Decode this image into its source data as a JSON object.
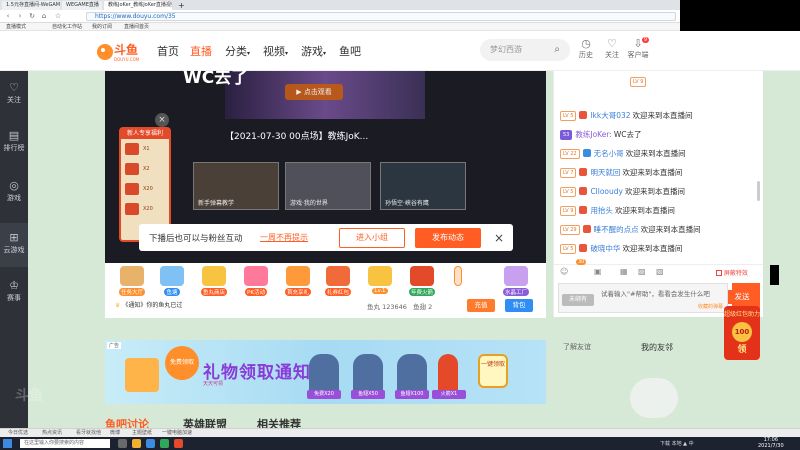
{
  "browser": {
    "tabs": [
      {
        "label": "1.5元存直播间-WeGAME官方"
      },
      {
        "label": "WEGAME直播"
      },
      {
        "label": "教练JoKer_教练JoKer直播视频_斗鱼"
      }
    ],
    "url": "https://www.douyu.com/35",
    "bookmarks": [
      "直播模式",
      "自动化工作站",
      "我的订阅",
      "直播间首页"
    ]
  },
  "header": {
    "logo_text": "斗鱼",
    "logo_sub": "DOUYU.COM",
    "nav": [
      {
        "label": "首页"
      },
      {
        "label": "直播"
      },
      {
        "label": "分类"
      },
      {
        "label": "视频"
      },
      {
        "label": "游戏"
      },
      {
        "label": "鱼吧"
      }
    ],
    "search_placeholder": "梦幻西游",
    "icons": [
      {
        "label": "历史",
        "icon": "clock-icon"
      },
      {
        "label": "关注",
        "icon": "heart-icon"
      },
      {
        "label": "客户端",
        "icon": "download-icon"
      }
    ],
    "client_badge": "9"
  },
  "sidebar": {
    "items": [
      {
        "label": "关注",
        "icon": "heart-icon"
      },
      {
        "label": "排行榜",
        "icon": "rank-icon"
      },
      {
        "label": "游戏",
        "icon": "gamepad-icon"
      },
      {
        "label": "云游戏",
        "icon": "cloud-game-icon"
      },
      {
        "label": "赛事",
        "icon": "trophy-icon"
      }
    ]
  },
  "player": {
    "streamer_tag": "WC去了",
    "play_button": "点击观看",
    "video_title": "【2021-07-30 00点场】教练JoK...",
    "newbie_title": "新人专享福利",
    "newbie_items": [
      "X1",
      "X2",
      "X20",
      "X20"
    ],
    "thumbs": [
      "新手弹幕教学",
      "游戏·我的世界",
      "孙悟空·峡谷有鹰"
    ],
    "fan_bar": {
      "text": "下播后也可以与粉丝互动",
      "link": "一周不再提示",
      "join_button": "进入小组",
      "post_button": "发布动态"
    }
  },
  "giftbar": {
    "gifts": [
      {
        "label": "任务大厅",
        "color": "#ff8f2a"
      },
      {
        "label": "鱼塘",
        "color": "#2f8df3"
      },
      {
        "label": "鱼丸商店",
        "color": "#ff5d23"
      },
      {
        "label": "PK活动",
        "color": "#ff5d23"
      },
      {
        "label": "首充享礼",
        "color": "#ff5d23"
      },
      {
        "label": "礼券红包",
        "color": "#ff5d23"
      },
      {
        "label": "Lv.1",
        "color": "#ff8f2a"
      },
      {
        "label": "年费火箭",
        "color": "#2fa85a"
      },
      {
        "label": "水晶工厂",
        "color": "#8a5cd9"
      }
    ],
    "rank_text": "《通知》你的鱼丸已过",
    "fish_balls": "鱼丸 123646",
    "fish_fins": "鱼翅 2",
    "recharge": "充值",
    "backpack": "背包"
  },
  "chat": {
    "top_label": "LV 9",
    "messages": [
      {
        "level": "LV 5",
        "name": "lkk大哥032",
        "text": "欢迎来到本直播间"
      },
      {
        "level": "53",
        "name": "教练JoKer:",
        "text": "WC去了"
      },
      {
        "level": "LV 22",
        "name": "无名小哥",
        "text": "欢迎来到本直播间"
      },
      {
        "level": "LV 7",
        "name": "明天就回",
        "text": "欢迎来到本直播间"
      },
      {
        "level": "LV 5",
        "name": "Cllooudy",
        "text": "欢迎来到本直播间"
      },
      {
        "level": "LV 9",
        "name": "用抬头",
        "text": "欢迎来到本直播间"
      },
      {
        "level": "LV 29",
        "name": "睡不醒的点点",
        "text": "欢迎来到本直播间"
      },
      {
        "level": "LV 5",
        "name": "破晓中华",
        "text": "欢迎来到本直播间"
      }
    ],
    "block_effects": "屏蔽特效",
    "tool_count": "30",
    "input_placeholder": "试着输入\"#帮助\"，看看会发生什么吧",
    "unbound": "未绑有",
    "send": "发送",
    "hint": "收藏的弹幕"
  },
  "friends": {
    "left": "了解友谊",
    "right": "我的友邻"
  },
  "redpack": {
    "send": "发送",
    "title": "超级红包助力",
    "coin": "100",
    "grab": "领"
  },
  "promo": {
    "tag": "广告",
    "badge": "免费领取",
    "title": "礼物领取通知",
    "subtitle": "天天可领",
    "horns": [
      "免费X20",
      "鱼翅X50",
      "鱼翅X100",
      "火箭X1"
    ],
    "one_click": "一键领取"
  },
  "bottom": {
    "headings": [
      {
        "label": "鱼吧讨论",
        "color": "#ff5d23"
      },
      {
        "label": "英雄联盟",
        "color": "#333333"
      },
      {
        "label": "相关推荐",
        "color": "#333333"
      }
    ]
  },
  "statusbar": {
    "items": [
      "今日优选",
      "热点资讯",
      "看牙就找他",
      "微博",
      "主题壁纸",
      "一键电脑加速"
    ]
  },
  "taskbar": {
    "search_placeholder": "在这里输入你要搜索的内容",
    "time": "17:06",
    "date": "2021/7/30",
    "tray": "下载 本地  ▲ 中"
  }
}
